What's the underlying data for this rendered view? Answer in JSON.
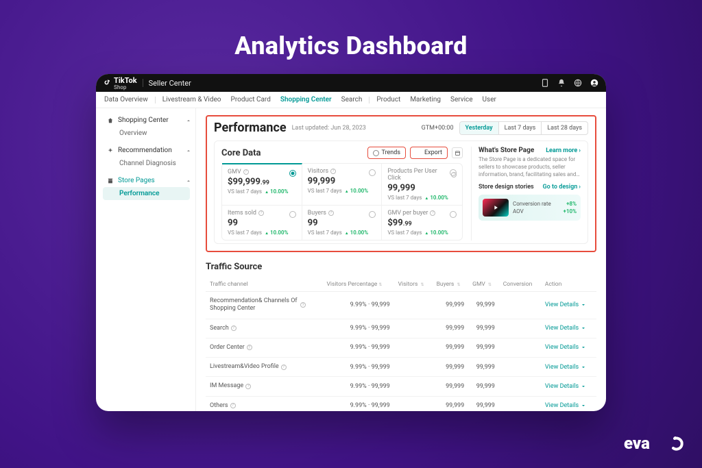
{
  "page_heading": "Analytics Dashboard",
  "topbar": {
    "brand_top": "TikTok",
    "brand_sub": "Shop",
    "section": "Seller Center"
  },
  "tabs": {
    "items": [
      "Data Overview",
      "Livestream & Video",
      "Product Card",
      "Shopping Center",
      "Search",
      "Product",
      "Marketing",
      "Service",
      "User"
    ],
    "active_index": 3
  },
  "sidebar": {
    "groups": [
      {
        "label": "Shopping Center",
        "items": [
          "Overview"
        ],
        "active": false,
        "active_item": -1
      },
      {
        "label": "Recommendation",
        "items": [
          "Channel Diagnosis"
        ],
        "active": false,
        "active_item": -1
      },
      {
        "label": "Store Pages",
        "items": [
          "Performance"
        ],
        "active": true,
        "active_item": 0
      }
    ]
  },
  "performance": {
    "title": "Performance",
    "last_updated_label": "Last updated:",
    "last_updated_value": "Jun 28, 2023",
    "gmt": "GTM+00:00",
    "ranges": [
      "Yesterday",
      "Last 7 days",
      "Last 28 days"
    ],
    "active_range": 0
  },
  "core": {
    "title": "Core Data",
    "trends_label": "Trends",
    "export_label": "Export",
    "compare_label": "VS last 7 days",
    "metrics": [
      {
        "label": "GMV",
        "value_prefix": "$",
        "value": "99,999",
        "value_suffix": ".99",
        "change": "10.00%",
        "selected": true
      },
      {
        "label": "Visitors",
        "value_prefix": "",
        "value": "99,999",
        "value_suffix": "",
        "change": "10.00%",
        "selected": false
      },
      {
        "label": "Products Per User Click",
        "value_prefix": "",
        "value": "99,999",
        "value_suffix": "",
        "change": "10.00%",
        "selected": false
      },
      {
        "label": "Items sold",
        "value_prefix": "",
        "value": "99",
        "value_suffix": "",
        "change": "10.00%",
        "selected": false
      },
      {
        "label": "Buyers",
        "value_prefix": "",
        "value": "99",
        "value_suffix": "",
        "change": "10.00%",
        "selected": false
      },
      {
        "label": "GMV per buyer",
        "value_prefix": "$",
        "value": "99",
        "value_suffix": ".99",
        "change": "10.00%",
        "selected": false
      }
    ]
  },
  "store_page": {
    "title": "What's Store Page",
    "learn_more": "Learn more",
    "desc": "The Store Page is a dedicated space for sellers to showcase products, seller information, brand, facilitating sales and…",
    "design_heading": "Store design stories",
    "go_to_design": "Go to design",
    "stat1_label": "Conversion rate",
    "stat1_value": "+8%",
    "stat2_label": "AOV",
    "stat2_value": "+10%"
  },
  "traffic": {
    "title": "Traffic Source",
    "columns": [
      "Traffic channel",
      "Visitors Percentage",
      "Visitors",
      "Buyers",
      "GMV",
      "Conversion",
      "Action"
    ],
    "action_label": "View Details",
    "rows": [
      {
        "channel": "Recommendation& Channels Of Shopping Center",
        "pct": "9.99%",
        "visitors": "99,999",
        "buyers": "99,999",
        "gmv": "99,999"
      },
      {
        "channel": "Search",
        "pct": "9.99%",
        "visitors": "99,999",
        "buyers": "99,999",
        "gmv": "99,999"
      },
      {
        "channel": "Order Center",
        "pct": "9.99%",
        "visitors": "99,999",
        "buyers": "99,999",
        "gmv": "99,999"
      },
      {
        "channel": "Livestream&Video Profile",
        "pct": "9.99%",
        "visitors": "99,999",
        "buyers": "99,999",
        "gmv": "99,999"
      },
      {
        "channel": "IM Message",
        "pct": "9.99%",
        "visitors": "99,999",
        "buyers": "99,999",
        "gmv": "99,999"
      },
      {
        "channel": "Others",
        "pct": "9.99%",
        "visitors": "99,999",
        "buyers": "99,999",
        "gmv": "99,999"
      }
    ]
  }
}
